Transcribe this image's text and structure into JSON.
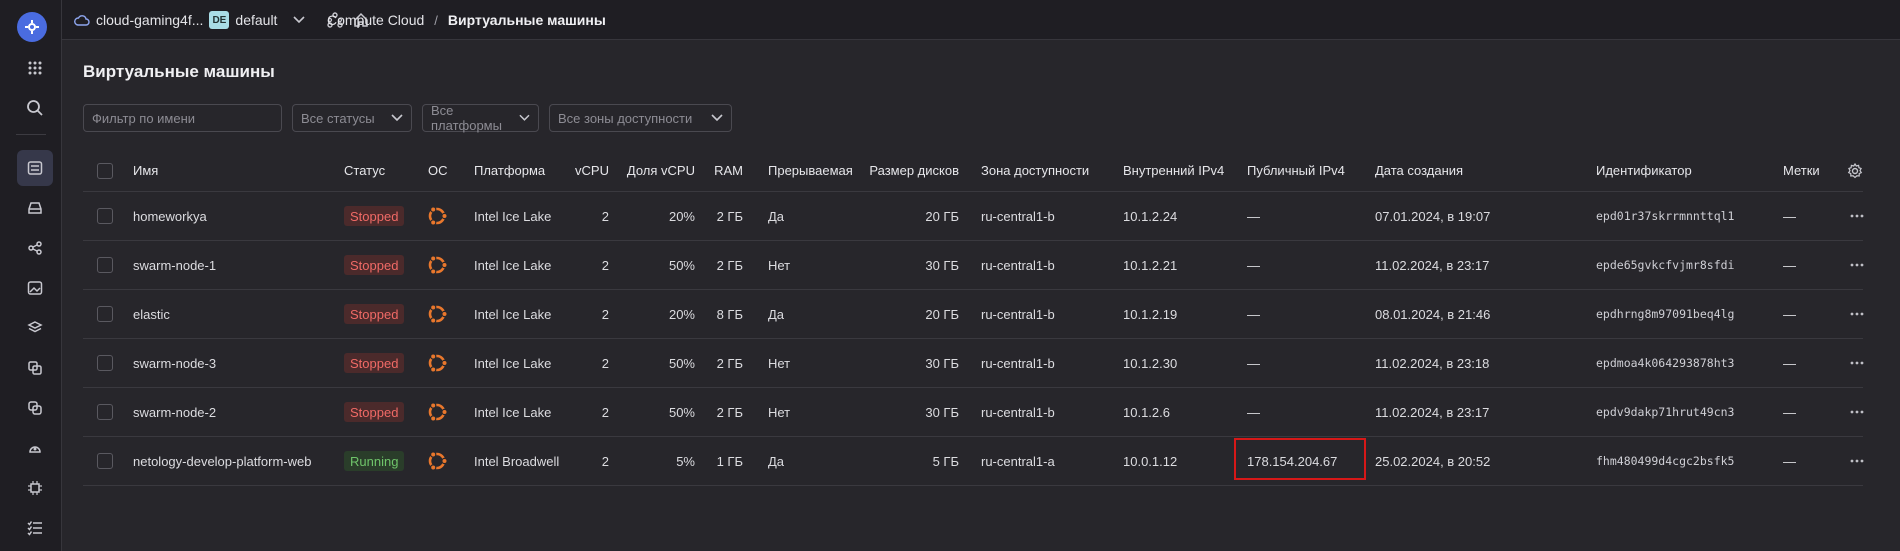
{
  "topbar": {
    "cloud_name": "cloud-gaming4f...",
    "folder_badge": "DE",
    "folder_name": "default",
    "breadcrumb_service": "Compute Cloud",
    "breadcrumb_separator": "/",
    "breadcrumb_current": "Виртуальные машины"
  },
  "page": {
    "title": "Виртуальные машины"
  },
  "filters": {
    "name_placeholder": "Фильтр по имени",
    "status": "Все статусы",
    "platform": "Все платформы",
    "zone": "Все зоны доступности"
  },
  "table": {
    "columns": {
      "name": "Имя",
      "status": "Статус",
      "os": "ОС",
      "platform": "Платформа",
      "vcpu": "vCPU",
      "vcpu_share": "Доля vCPU",
      "ram": "RAM",
      "preemptible": "Прерываемая",
      "disk_size": "Размер дисков",
      "zone": "Зона доступности",
      "internal_ip": "Внутренний IPv4",
      "public_ip": "Публичный IPv4",
      "created": "Дата создания",
      "id": "Идентификатор",
      "labels": "Метки"
    },
    "rows": [
      {
        "name": "homeworkya",
        "status": "Stopped",
        "platform": "Intel Ice Lake",
        "vcpu": "2",
        "share": "20%",
        "ram": "2 ГБ",
        "preemptible": "Да",
        "disk": "20 ГБ",
        "zone": "ru-central1-b",
        "internal_ip": "10.1.2.24",
        "public_ip": "—",
        "created": "07.01.2024, в 19:07",
        "id": "epd01r37skrrmnnttql1",
        "labels": "—"
      },
      {
        "name": "swarm-node-1",
        "status": "Stopped",
        "platform": "Intel Ice Lake",
        "vcpu": "2",
        "share": "50%",
        "ram": "2 ГБ",
        "preemptible": "Нет",
        "disk": "30 ГБ",
        "zone": "ru-central1-b",
        "internal_ip": "10.1.2.21",
        "public_ip": "—",
        "created": "11.02.2024, в 23:17",
        "id": "epde65gvkcfvjmr8sfdi",
        "labels": "—"
      },
      {
        "name": "elastic",
        "status": "Stopped",
        "platform": "Intel Ice Lake",
        "vcpu": "2",
        "share": "20%",
        "ram": "8 ГБ",
        "preemptible": "Да",
        "disk": "20 ГБ",
        "zone": "ru-central1-b",
        "internal_ip": "10.1.2.19",
        "public_ip": "—",
        "created": "08.01.2024, в 21:46",
        "id": "epdhrng8m97091beq4lg",
        "labels": "—"
      },
      {
        "name": "swarm-node-3",
        "status": "Stopped",
        "platform": "Intel Ice Lake",
        "vcpu": "2",
        "share": "50%",
        "ram": "2 ГБ",
        "preemptible": "Нет",
        "disk": "30 ГБ",
        "zone": "ru-central1-b",
        "internal_ip": "10.1.2.30",
        "public_ip": "—",
        "created": "11.02.2024, в 23:18",
        "id": "epdmoa4k064293878ht3",
        "labels": "—"
      },
      {
        "name": "swarm-node-2",
        "status": "Stopped",
        "platform": "Intel Ice Lake",
        "vcpu": "2",
        "share": "50%",
        "ram": "2 ГБ",
        "preemptible": "Нет",
        "disk": "30 ГБ",
        "zone": "ru-central1-b",
        "internal_ip": "10.1.2.6",
        "public_ip": "—",
        "created": "11.02.2024, в 23:17",
        "id": "epdv9dakp71hrut49cn3",
        "labels": "—"
      },
      {
        "name": "netology-develop-platform-web",
        "status": "Running",
        "platform": "Intel Broadwell",
        "vcpu": "2",
        "share": "5%",
        "ram": "1 ГБ",
        "preemptible": "Да",
        "disk": "5 ГБ",
        "zone": "ru-central1-a",
        "internal_ip": "10.0.1.12",
        "public_ip": "178.154.204.67",
        "created": "25.02.2024, в 20:52",
        "id": "fhm480499d4cgc2bsfk5",
        "labels": "—"
      }
    ]
  },
  "colors": {
    "stopped": "#f06a66",
    "running": "#6fc46a",
    "ubuntu": "#e9772c",
    "highlight": "#d61818"
  }
}
